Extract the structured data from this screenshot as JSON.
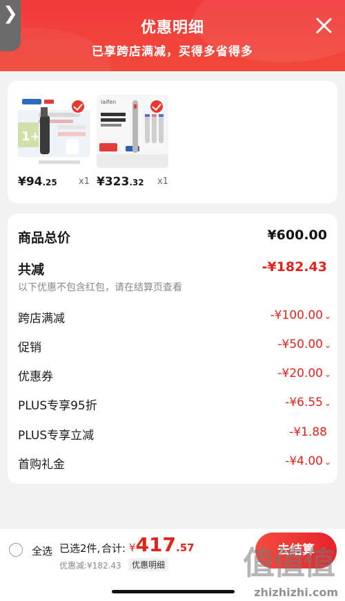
{
  "header": {
    "back_glyph": "❯",
    "title": "优惠明细",
    "subtitle": "已享跨店满减，买得多省得多",
    "close_icon": "close-icon"
  },
  "products": [
    {
      "brand": "",
      "price_int": "¥94",
      "price_dec": ".25",
      "qty": "x1",
      "selected": true
    },
    {
      "brand": "laifen",
      "price_int": "¥323",
      "price_dec": ".32",
      "qty": "x1",
      "selected": true
    }
  ],
  "summary": {
    "goods_total_label": "商品总价",
    "goods_total_value": "¥600.00",
    "total_discount_label": "共减",
    "total_discount_value": "-¥182.43",
    "note": "以下优惠不包含红包，请在结算页查看",
    "items": [
      {
        "label": "跨店满减",
        "value": "-¥100.00",
        "chevron": "⌄"
      },
      {
        "label": "促销",
        "value": "-¥50.00",
        "chevron": "⌄"
      },
      {
        "label": "优惠券",
        "value": "-¥20.00",
        "chevron": "⌄"
      },
      {
        "label": "PLUS专享95折",
        "value": "-¥6.55",
        "chevron": "⌄"
      },
      {
        "label": "PLUS专享立减",
        "value": "-¥1.88",
        "chevron": ""
      },
      {
        "label": "首购礼金",
        "value": "-¥4.00",
        "chevron": "⌄"
      }
    ]
  },
  "bottom": {
    "select_all": "全选",
    "selected_count": "已选2件,",
    "total_label": "合计:",
    "total_currency": "¥",
    "total_int": "417",
    "total_dec": ".57",
    "discount_text": "优惠减:¥182.43",
    "detail_link": "优惠明细",
    "checkout": "去结算",
    "watermark": "值值值",
    "watermark_sub": "zhizhizhi.com"
  },
  "colors": {
    "header_red": "#f23a3c",
    "accent_red": "#e2231a",
    "check_red": "#e8392f"
  }
}
